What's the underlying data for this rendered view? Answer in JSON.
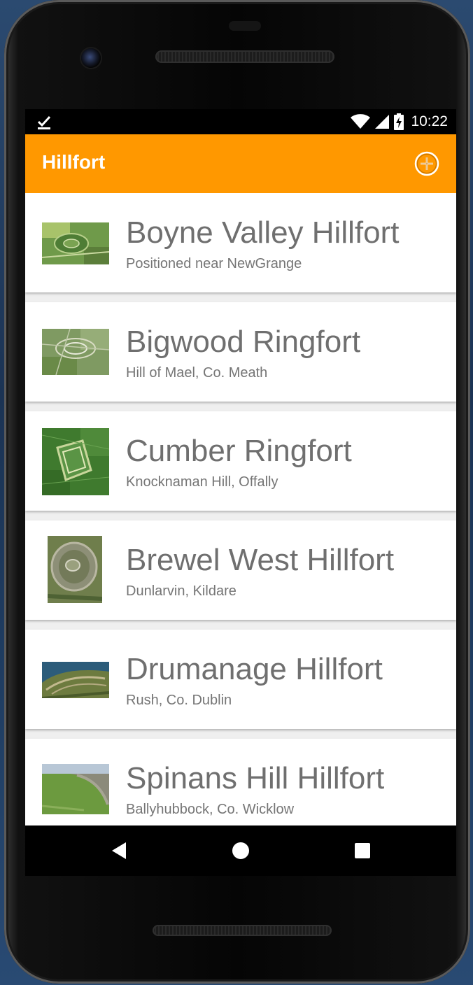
{
  "status_bar": {
    "time": "10:22",
    "icons": [
      "download-done-icon",
      "wifi-icon",
      "signal-icon",
      "battery-charging-icon"
    ]
  },
  "app_bar": {
    "title": "Hillfort",
    "add_icon": "add-circle-icon",
    "color": "#ff9800"
  },
  "hillforts": [
    {
      "title": "Boyne Valley Hillfort",
      "subtitle": "Positioned near NewGrange"
    },
    {
      "title": "Bigwood Ringfort",
      "subtitle": "Hill of Mael, Co. Meath"
    },
    {
      "title": "Cumber Ringfort",
      "subtitle": "Knocknaman Hill, Offally"
    },
    {
      "title": "Brewel West Hillfort",
      "subtitle": "Dunlarvin, Kildare"
    },
    {
      "title": "Drumanage Hillfort",
      "subtitle": "Rush, Co. Dublin"
    },
    {
      "title": "Spinans Hill Hillfort",
      "subtitle": "Ballyhubbock, Co. Wicklow"
    }
  ],
  "nav_bar": {
    "icons": [
      "back-icon",
      "home-icon",
      "recents-icon"
    ]
  }
}
